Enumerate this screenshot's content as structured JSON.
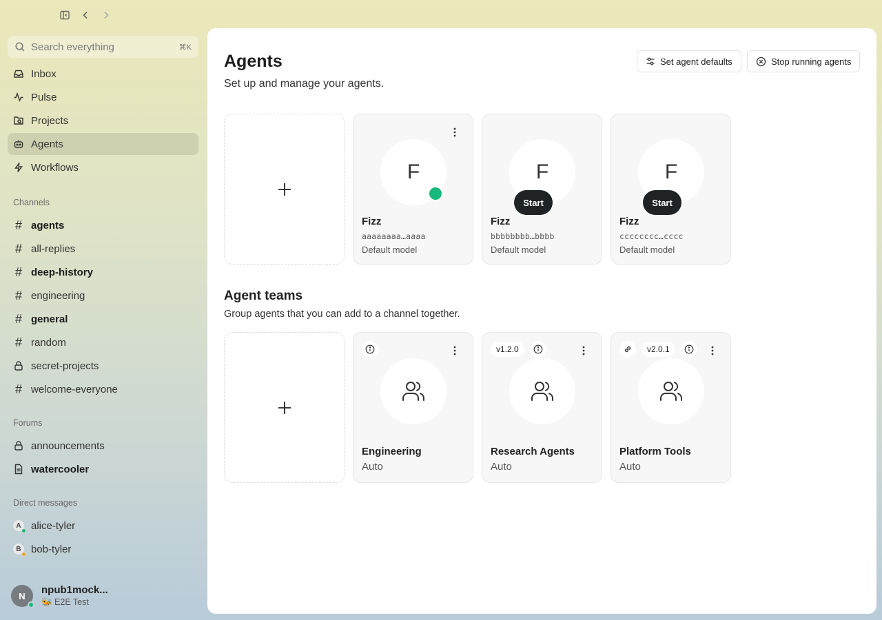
{
  "search": {
    "placeholder": "Search everything",
    "shortcut": "⌘K"
  },
  "nav": [
    {
      "label": "Inbox",
      "icon": "inbox-icon"
    },
    {
      "label": "Pulse",
      "icon": "pulse-icon"
    },
    {
      "label": "Projects",
      "icon": "projects-icon"
    },
    {
      "label": "Agents",
      "icon": "agents-icon",
      "active": true
    },
    {
      "label": "Workflows",
      "icon": "lightning-icon"
    }
  ],
  "channels": {
    "title": "Channels",
    "items": [
      {
        "label": "agents",
        "bold": true,
        "icon": "hash-icon"
      },
      {
        "label": "all-replies",
        "bold": false,
        "icon": "hash-icon"
      },
      {
        "label": "deep-history",
        "bold": true,
        "icon": "hash-icon"
      },
      {
        "label": "engineering",
        "bold": false,
        "icon": "hash-icon"
      },
      {
        "label": "general",
        "bold": true,
        "icon": "hash-icon"
      },
      {
        "label": "random",
        "bold": false,
        "icon": "hash-icon"
      },
      {
        "label": "secret-projects",
        "bold": false,
        "icon": "lock-icon"
      },
      {
        "label": "welcome-everyone",
        "bold": false,
        "icon": "hash-icon"
      }
    ]
  },
  "forums": {
    "title": "Forums",
    "items": [
      {
        "label": "announcements",
        "bold": false,
        "icon": "lock-icon"
      },
      {
        "label": "watercooler",
        "bold": true,
        "icon": "document-icon"
      }
    ]
  },
  "dms": {
    "title": "Direct messages",
    "items": [
      {
        "label": "alice-tyler",
        "initial": "A",
        "status_color": "#18b97a"
      },
      {
        "label": "bob-tyler",
        "initial": "B",
        "status_color": "#f0a020"
      }
    ]
  },
  "user": {
    "initial": "N",
    "name": "npub1mock...",
    "status": "🐝 E2E Test"
  },
  "page": {
    "title": "Agents",
    "subtitle": "Set up and manage your agents.",
    "btn_defaults": "Set agent defaults",
    "btn_stop": "Stop running agents"
  },
  "agents": [
    {
      "initial": "F",
      "name": "Fizz",
      "key": "aaaaaaaa…aaaa",
      "model": "Default model",
      "running": true
    },
    {
      "initial": "F",
      "name": "Fizz",
      "key": "bbbbbbbb…bbbb",
      "model": "Default model",
      "running": false,
      "start_label": "Start"
    },
    {
      "initial": "F",
      "name": "Fizz",
      "key": "cccccccc…cccc",
      "model": "Default model",
      "running": false,
      "start_label": "Start"
    }
  ],
  "teams_section": {
    "title": "Agent teams",
    "subtitle": "Group agents that you can add to a channel together."
  },
  "teams": [
    {
      "name": "Engineering",
      "mode": "Auto",
      "version": "",
      "linked": false
    },
    {
      "name": "Research Agents",
      "mode": "Auto",
      "version": "v1.2.0",
      "linked": false
    },
    {
      "name": "Platform Tools",
      "mode": "Auto",
      "version": "v2.0.1",
      "linked": true
    }
  ],
  "colors": {
    "online": "#18b97a",
    "away": "#f0a020",
    "start_button": "#1f2326"
  }
}
